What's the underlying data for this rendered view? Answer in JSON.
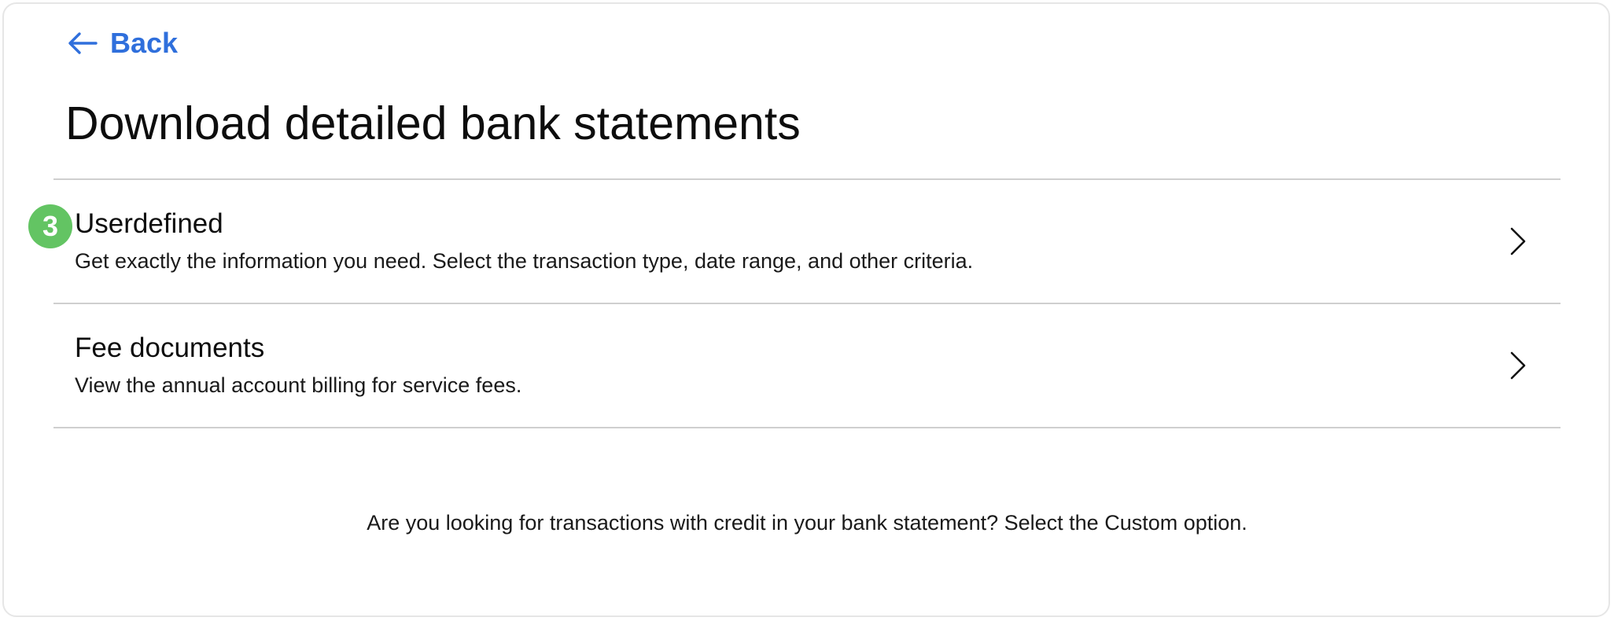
{
  "nav": {
    "back_label": "Back",
    "back_icon": "arrow-left-icon"
  },
  "page": {
    "title": "Download detailed bank statements"
  },
  "options": [
    {
      "title": "Userdefined",
      "description": "Get exactly the information you need. Select the transaction type, date range, and other criteria.",
      "icon": "chevron-right-icon"
    },
    {
      "title": "Fee documents",
      "description": "View the annual account billing for service fees.",
      "icon": "chevron-right-icon"
    }
  ],
  "step_badge": {
    "label": "3",
    "color": "#63c463"
  },
  "footer": {
    "note": "Are you looking for transactions with credit in your bank statement? Select the Custom option."
  },
  "colors": {
    "accent": "#2f6fdc",
    "divider": "#cfcfcf"
  }
}
